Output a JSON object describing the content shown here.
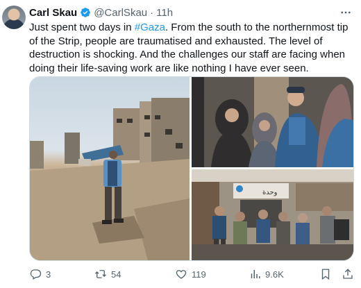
{
  "tweet": {
    "author_name": "Carl Skau",
    "handle": "@CarlSkau",
    "time": "11h",
    "text_before": "Just spent two days in ",
    "hashtag": "#Gaza",
    "text_after": ". From the south to the northernmost tip of the Strip, people are traumatised and exhausted. The level of destruction is shocking. And the challenges our staff are facing when doing their life-saving work are like nothing I have ever seen."
  },
  "media": {
    "images": [
      {
        "name": "rubble-street-photo"
      },
      {
        "name": "women-with-staff-photo"
      },
      {
        "name": "distribution-center-photo",
        "sign_text": "وحدة"
      }
    ]
  },
  "actions": {
    "replies": "3",
    "reposts": "54",
    "likes": "119",
    "views": "9.6K"
  },
  "icons": {
    "verified": "verified-badge-icon",
    "more": "more-options-icon",
    "reply": "reply-icon",
    "repost": "repost-icon",
    "like": "like-icon",
    "views": "views-icon",
    "bookmark": "bookmark-icon",
    "share": "share-icon"
  },
  "colors": {
    "link": "#1d9bf0",
    "verified": "#1d9bf0",
    "secondary": "#536471"
  }
}
